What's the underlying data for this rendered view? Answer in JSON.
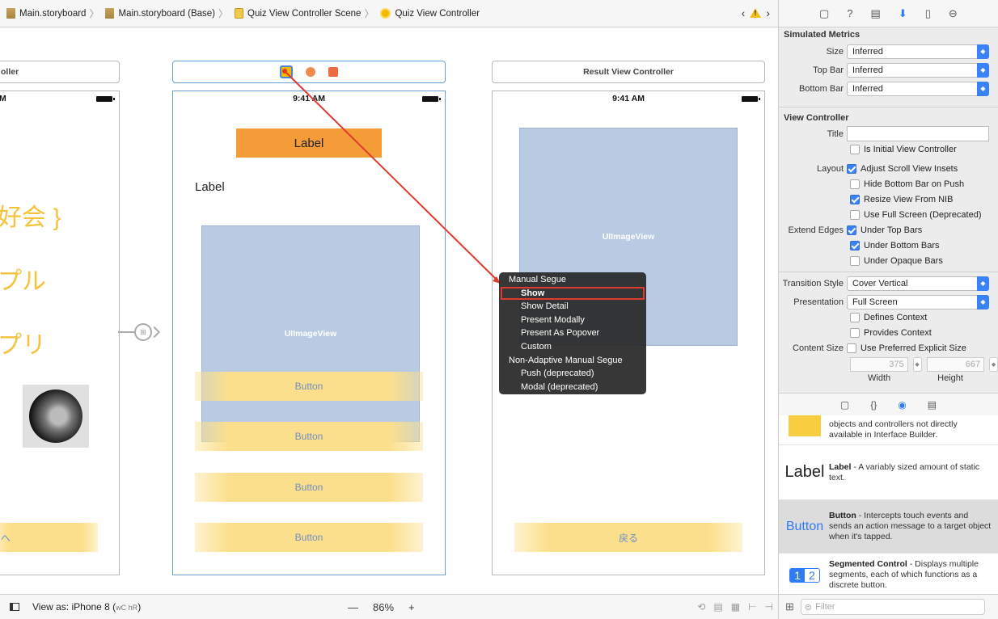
{
  "jumpbar": {
    "crumbs": [
      "Main.storyboard",
      "Main.storyboard (Base)",
      "Quiz View Controller Scene",
      "Quiz View Controller"
    ],
    "back_icon": "chevron-left-icon",
    "forward_icon": "chevron-right-icon",
    "warning_icon": "warning-icon"
  },
  "canvas": {
    "left_scene": {
      "title_fragment": "oller",
      "status_fragment": "M",
      "jp_lines": [
        "好会 }",
        "プル",
        "プリ"
      ],
      "button_fragment": "へ"
    },
    "quiz_scene": {
      "status_time": "9:41 AM",
      "orange_label": "Label",
      "plain_label": "Label",
      "image_view": "UIImageView",
      "buttons": [
        "Button",
        "Button",
        "Button",
        "Button"
      ]
    },
    "result_scene": {
      "title": "Result View Controller",
      "status_time": "9:41 AM",
      "image_view": "UIImageView",
      "back_button": "戻る"
    },
    "accent_color": "#f39c38",
    "connection_line_color": "#e03a2f"
  },
  "context_menu": {
    "items": [
      {
        "label": "Manual Segue",
        "header": true
      },
      {
        "label": "Show",
        "highlighted": true
      },
      {
        "label": "Show Detail"
      },
      {
        "label": "Present Modally"
      },
      {
        "label": "Present As Popover"
      },
      {
        "label": "Custom"
      },
      {
        "label": "Non-Adaptive Manual Segue",
        "header": true
      },
      {
        "label": "Push (deprecated)"
      },
      {
        "label": "Modal (deprecated)"
      }
    ]
  },
  "bottombar": {
    "view_as": "View as: iPhone 8 (",
    "size_class": "wC hR",
    "view_as_end": ")",
    "zoom_minus": "—",
    "zoom": "86%",
    "zoom_plus": "+"
  },
  "inspector": {
    "tabs": [
      "file-icon",
      "help-icon",
      "identity-icon",
      "attributes-icon",
      "size-icon",
      "connections-icon"
    ],
    "simulated_metrics": {
      "title": "Simulated Metrics",
      "size_label": "Size",
      "size_value": "Inferred",
      "topbar_label": "Top Bar",
      "topbar_value": "Inferred",
      "bottombar_label": "Bottom Bar",
      "bottombar_value": "Inferred"
    },
    "view_controller": {
      "title": "View Controller",
      "title_label": "Title",
      "title_value": "",
      "initial": "Is Initial View Controller",
      "layout_label": "Layout",
      "adjust_scroll": "Adjust Scroll View Insets",
      "hide_bottom": "Hide Bottom Bar on Push",
      "resize_nib": "Resize View From NIB",
      "full_screen": "Use Full Screen (Deprecated)",
      "extend_label": "Extend Edges",
      "under_top": "Under Top Bars",
      "under_bottom": "Under Bottom Bars",
      "under_opaque": "Under Opaque Bars",
      "transition_label": "Transition Style",
      "transition_value": "Cover Vertical",
      "presentation_label": "Presentation",
      "presentation_value": "Full Screen",
      "defines_context": "Defines Context",
      "provides_context": "Provides Context",
      "content_size_label": "Content Size",
      "preferred_size": "Use Preferred Explicit Size",
      "width_value": "375",
      "height_value": "667",
      "width_label": "Width",
      "height_label": "Height"
    },
    "library": {
      "tabs": [
        "file-template-icon",
        "code-snippet-icon",
        "object-icon",
        "media-icon"
      ],
      "items": [
        {
          "title": "",
          "desc": "objects and controllers not directly available in Interface Builder."
        },
        {
          "icon_text": "Label",
          "title": "Label",
          "desc": " - A variably sized amount of static text."
        },
        {
          "icon_text": "Button",
          "title": "Button",
          "desc": " - Intercepts touch events and sends an action message to a target object when it's tapped."
        },
        {
          "icon_text_1": "1",
          "icon_text_2": "2",
          "title": "Segmented Control",
          "desc": " - Displays multiple segments, each of which functions as a discrete button."
        }
      ],
      "filter_placeholder": "Filter"
    }
  }
}
